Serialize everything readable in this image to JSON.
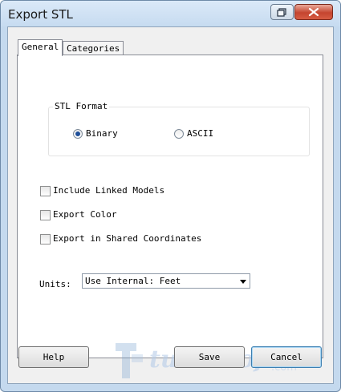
{
  "window": {
    "title": "Export STL"
  },
  "title_buttons": {
    "restore": "restore-icon",
    "close": "close-icon"
  },
  "tabs": [
    {
      "label": "General"
    },
    {
      "label": "Categories"
    }
  ],
  "stl_format": {
    "title": "STL Format",
    "options": [
      {
        "label": "Binary",
        "selected": true
      },
      {
        "label": "ASCII",
        "selected": false
      }
    ]
  },
  "checkboxes": [
    {
      "label": "Include Linked Models",
      "checked": false
    },
    {
      "label": "Export Color",
      "checked": false
    },
    {
      "label": "Export in Shared Coordinates",
      "checked": false
    }
  ],
  "units": {
    "label": "Units:",
    "value": "Use Internal: Feet"
  },
  "buttons": {
    "help": "Help",
    "save": "Save",
    "cancel": "Cancel"
  },
  "watermark": {
    "text": "tuituisoft",
    "suffix": ".com"
  },
  "colors": {
    "accent": "#3c7fb1",
    "radio_dot": "#1e4f99",
    "close_button": "#c5452f"
  }
}
